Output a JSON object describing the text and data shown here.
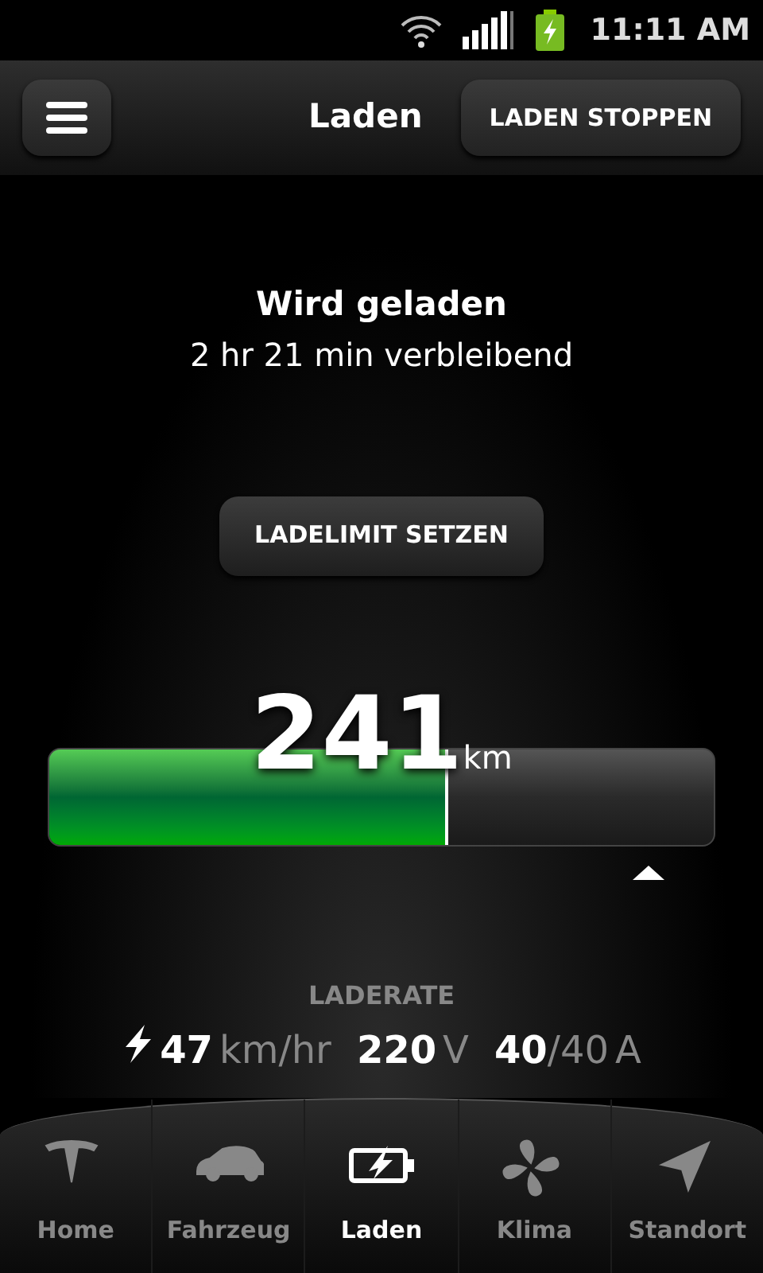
{
  "status_bar": {
    "time": "11:11 AM"
  },
  "header": {
    "title": "Laden",
    "action": "LADEN STOPPEN"
  },
  "charging": {
    "state": "Wird geladen",
    "remaining": "2 hr 21 min verbleibend"
  },
  "limit_button": "LADELIMIT SETZEN",
  "gauge": {
    "value": "241",
    "unit": "km",
    "level": 0.6
  },
  "rate": {
    "label": "LADERATE",
    "speed": "47",
    "speed_unit": "km/hr",
    "voltage": "220",
    "voltage_unit": "V",
    "current": "40",
    "current_max": "/40",
    "current_unit": "A"
  },
  "nav": [
    {
      "kind": "tesla",
      "label": "Home",
      "selected": false
    },
    {
      "kind": "car",
      "label": "Fahrzeug",
      "selected": false
    },
    {
      "kind": "charge",
      "label": "Laden",
      "selected": true
    },
    {
      "kind": "fan",
      "label": "Klima",
      "selected": false
    },
    {
      "kind": "location",
      "label": "Standort",
      "selected": false
    }
  ]
}
